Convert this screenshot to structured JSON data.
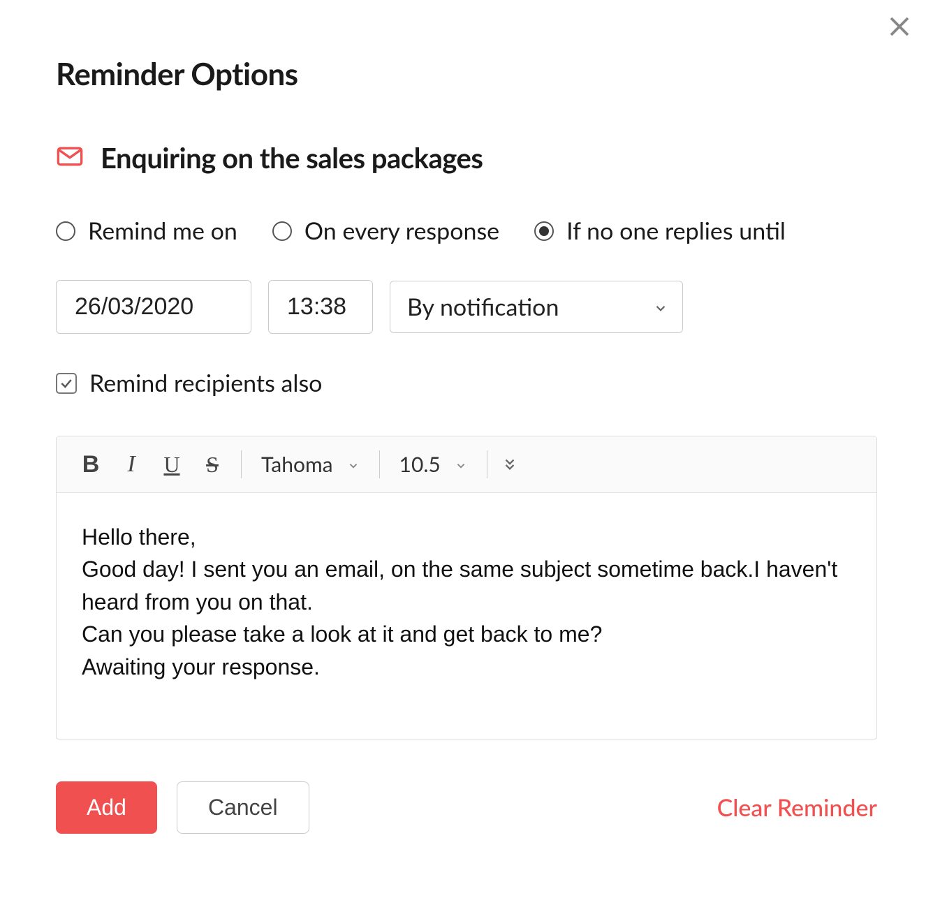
{
  "dialog": {
    "title": "Reminder Options",
    "subject": "Enquiring on the sales packages"
  },
  "radios": {
    "remind_me_on": "Remind me on",
    "on_every_response": "On every response",
    "if_no_one_replies": "If no one replies until",
    "selected": "if_no_one_replies"
  },
  "inputs": {
    "date": "26/03/2020",
    "time": "13:38",
    "method": "By notification"
  },
  "checkbox": {
    "remind_recipients": "Remind recipients also",
    "checked": true
  },
  "toolbar": {
    "bold": "B",
    "italic": "I",
    "underline": "U",
    "strike": "S",
    "font_family": "Tahoma",
    "font_size": "10.5"
  },
  "message": {
    "line1": "Hello there,",
    "line2": "Good day! I sent you an email, on the same subject sometime back.I haven't heard from you on that.",
    "line3": "Can you please take a look at it and get back to me?",
    "line4": "Awaiting your response."
  },
  "footer": {
    "add": "Add",
    "cancel": "Cancel",
    "clear": "Clear Reminder"
  }
}
